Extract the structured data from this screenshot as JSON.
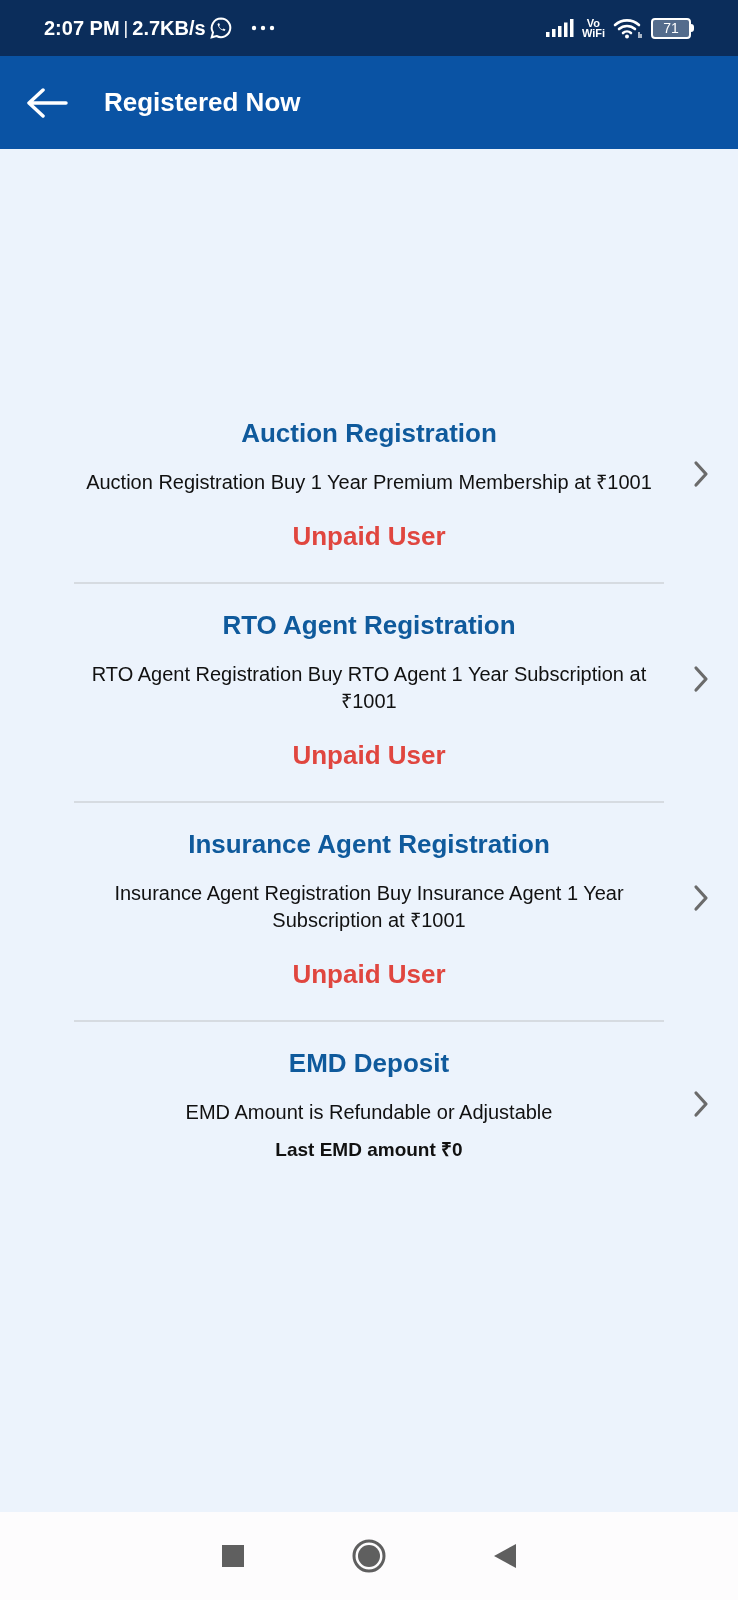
{
  "status_bar": {
    "time": "2:07 PM",
    "separator": "|",
    "speed": "2.7KB/s",
    "vowifi_top": "Vo",
    "vowifi_bottom": "WiFi",
    "battery": "71"
  },
  "app_bar": {
    "title": "Registered Now"
  },
  "sections": [
    {
      "title": "Auction Registration",
      "description": "Auction Registration Buy 1 Year Premium Membership at ₹1001",
      "footer": {
        "kind": "status",
        "text": "Unpaid User"
      }
    },
    {
      "title": "RTO Agent Registration",
      "description": "RTO Agent Registration Buy RTO Agent 1 Year Subscription at ₹1001",
      "footer": {
        "kind": "status",
        "text": "Unpaid User"
      }
    },
    {
      "title": "Insurance Agent Registration",
      "description": "Insurance Agent Registration Buy Insurance Agent 1 Year Subscription at ₹1001",
      "footer": {
        "kind": "status",
        "text": "Unpaid User"
      }
    },
    {
      "title": "EMD Deposit",
      "description": "EMD Amount is Refundable or Adjustable",
      "footer": {
        "kind": "amount",
        "text": "Last EMD amount ₹0"
      }
    }
  ]
}
